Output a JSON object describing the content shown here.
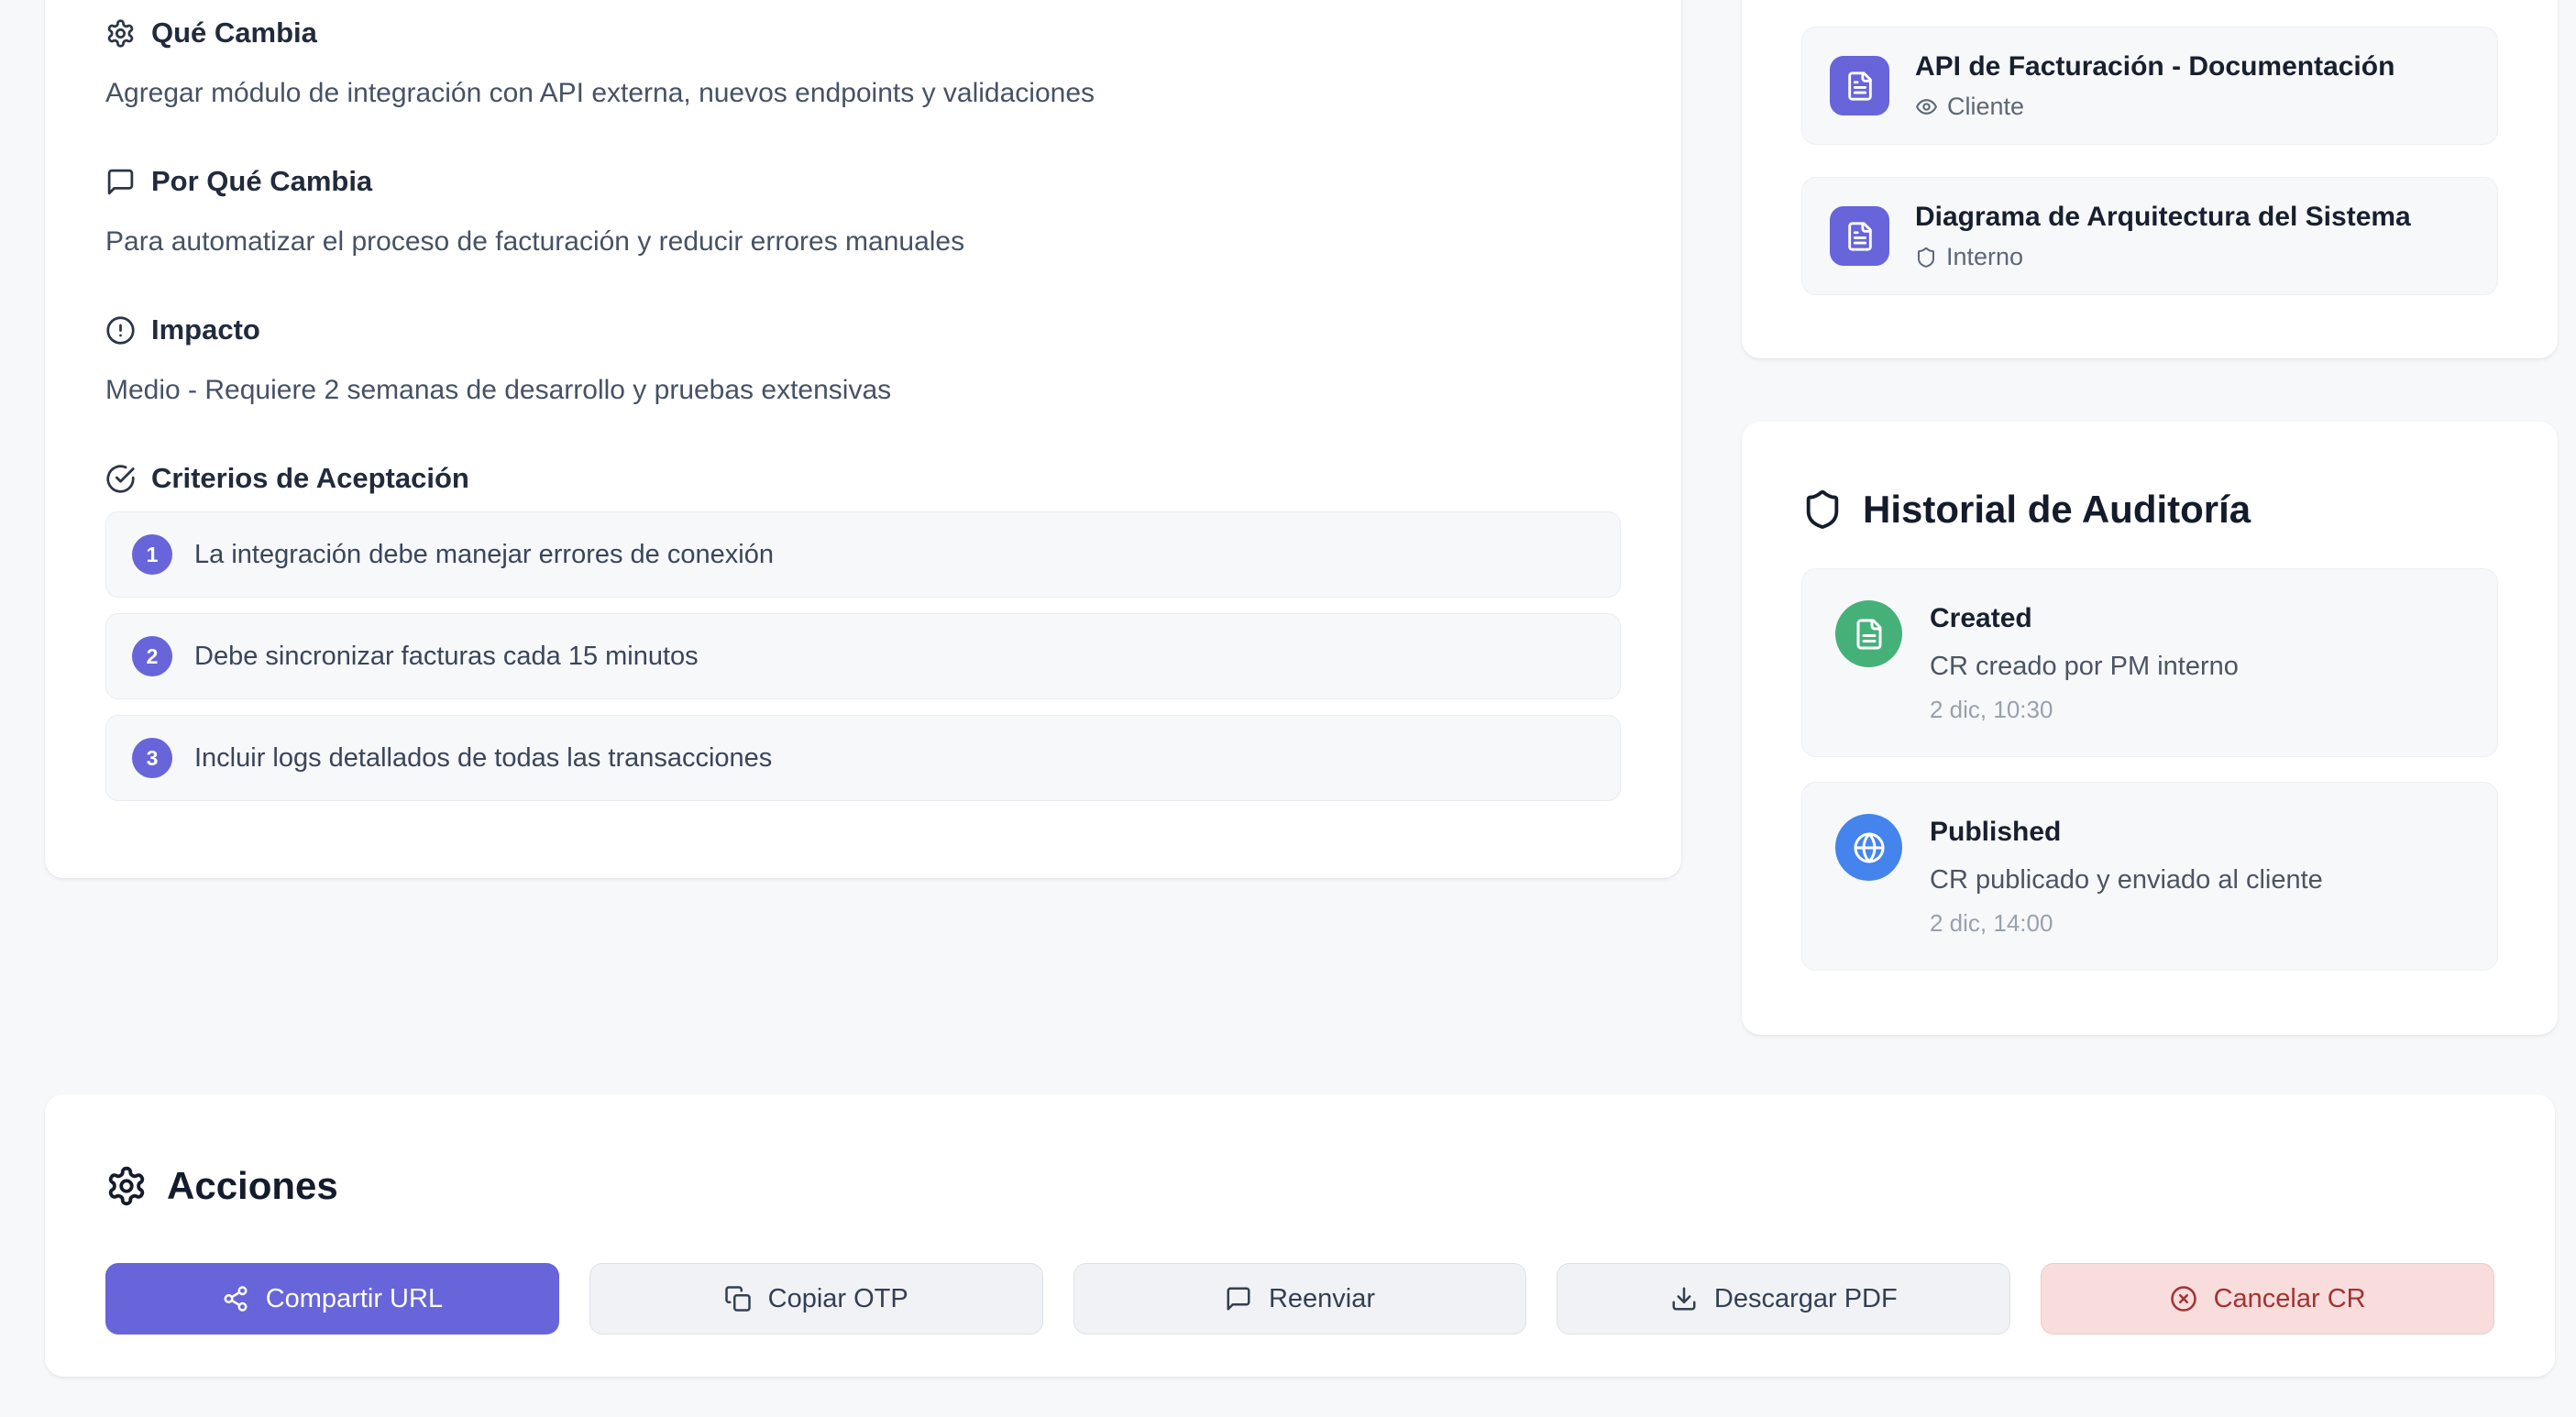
{
  "colors": {
    "page_bg": "#f7f8fa",
    "accent_indigo": "#6765d9",
    "success_green": "#45b179",
    "info_blue": "#4584ec",
    "danger_bg": "#f9dcdc",
    "danger_text": "#a23333"
  },
  "details_card": {
    "sections": [
      {
        "icon": "gear-icon",
        "title": "Qué Cambia",
        "body": "Agregar módulo de integración con API externa, nuevos endpoints y validaciones"
      },
      {
        "icon": "message-square-icon",
        "title": "Por Qué Cambia",
        "body": "Para automatizar el proceso de facturación y reducir errores manuales"
      },
      {
        "icon": "alert-circle-icon",
        "title": "Impacto",
        "body": "Medio - Requiere 2 semanas de desarrollo y pruebas extensivas"
      }
    ],
    "criteria": {
      "icon": "check-circle-icon",
      "title": "Criterios de Aceptación",
      "items": [
        {
          "number": "1",
          "text": "La integración debe manejar errores de conexión"
        },
        {
          "number": "2",
          "text": "Debe sincronizar facturas cada 15 minutos"
        },
        {
          "number": "3",
          "text": "Incluir logs detallados de todas las transacciones"
        }
      ]
    }
  },
  "attachments_card": {
    "items": [
      {
        "icon": "file-text-icon",
        "title": "API de Facturación - Documentación",
        "visibility_icon": "eye-icon",
        "visibility": "Cliente"
      },
      {
        "icon": "file-text-icon",
        "title": "Diagrama de Arquitectura del Sistema",
        "visibility_icon": "shield-icon",
        "visibility": "Interno"
      }
    ]
  },
  "audit_card": {
    "icon": "shield-icon",
    "title": "Historial de Auditoría",
    "entries": [
      {
        "icon": "file-text-icon",
        "color": "#45b179",
        "event": "Created",
        "description": "CR creado por PM interno",
        "timestamp": "2 dic, 10:30"
      },
      {
        "icon": "globe-icon",
        "color": "#4584ec",
        "event": "Published",
        "description": "CR publicado y enviado al cliente",
        "timestamp": "2 dic, 14:00"
      }
    ]
  },
  "actions_card": {
    "icon": "gear-icon",
    "title": "Acciones",
    "buttons": [
      {
        "label": "Compartir URL",
        "icon": "share-icon",
        "style": "primary"
      },
      {
        "label": "Copiar OTP",
        "icon": "copy-icon",
        "style": "secondary"
      },
      {
        "label": "Reenviar",
        "icon": "message-square-icon",
        "style": "secondary"
      },
      {
        "label": "Descargar PDF",
        "icon": "download-icon",
        "style": "secondary"
      },
      {
        "label": "Cancelar CR",
        "icon": "circle-x-icon",
        "style": "danger"
      }
    ]
  }
}
